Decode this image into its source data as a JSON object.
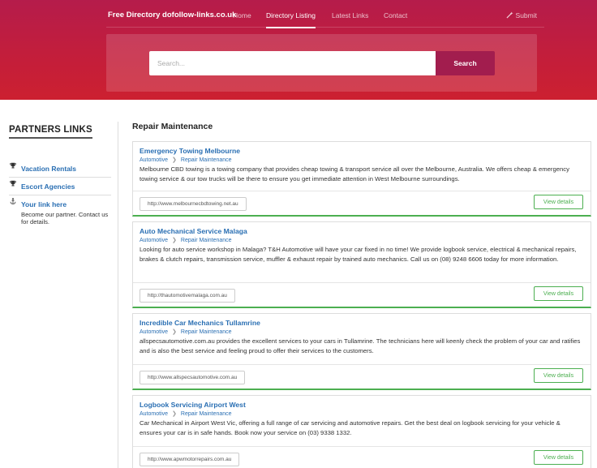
{
  "nav": {
    "brand": "Free Directory dofollow-links.co.uk",
    "links": [
      "Home",
      "Directory Listing",
      "Latest Links",
      "Contact"
    ],
    "submit": "Submit"
  },
  "search": {
    "placeholder": "Search...",
    "button": "Search"
  },
  "sidebar": {
    "title": "PARTNERS LINKS",
    "partners": [
      {
        "label": "Vacation Rentals",
        "icon": "trophy-icon"
      },
      {
        "label": "Escort Agencies",
        "icon": "trophy-icon"
      },
      {
        "label": "Your link here",
        "icon": "anchor-icon",
        "desc": "Become our partner. Contact us for details."
      }
    ]
  },
  "main": {
    "title": "Repair Maintenance",
    "view_label": "View details",
    "listings": [
      {
        "title": "Emergency Towing Melbourne",
        "crumbs": [
          "Automotive",
          "Repair Maintenance"
        ],
        "desc": "Melbourne CBD towing is a towing company that provides cheap towing & transport service all over the Melbourne, Australia. We offers cheap & emergency towing service & our tow trucks will be there to ensure you get immediate attention in West Melbourne surroundings.",
        "url": "http://www.melbournecbdtowing.net.au"
      },
      {
        "title": "Auto Mechanical Service Malaga",
        "crumbs": [
          "Automotive",
          "Repair Maintenance"
        ],
        "desc": "Looking for auto service workshop in Malaga? T&H Automotive will have your car fixed in no time! We provide logbook service, electrical & mechanical repairs, brakes & clutch repairs, transmission service, muffler & exhaust repair by trained auto mechanics. Call us on (08) 9248 6606 today for more information.",
        "url": "http://thautomotivemalaga.com.au"
      },
      {
        "title": "Incredible Car Mechanics Tullamrine",
        "crumbs": [
          "Automotive",
          "Repair Maintenance"
        ],
        "desc": "allspecsautomotive.com.au provides the excellent services to your cars in Tullamrine. The technicians here will keenly check the problem of your car and ratifies and is also the best service and feeling proud to offer their services to the customers.",
        "url": "http://www.allspecsautomotive.com.au"
      },
      {
        "title": "Logbook Servicing Airport West",
        "crumbs": [
          "Automotive",
          "Repair Maintenance"
        ],
        "desc": "Car Mechanical in Airport West Vic, offering a full range of car servicing and automotive repairs. Get the best deal on logbook servicing for your vehicle & ensures your car is in safe hands. Book now your service on (03) 9338 1332.",
        "url": "http://www.apwmotorrepairs.com.au"
      }
    ]
  }
}
